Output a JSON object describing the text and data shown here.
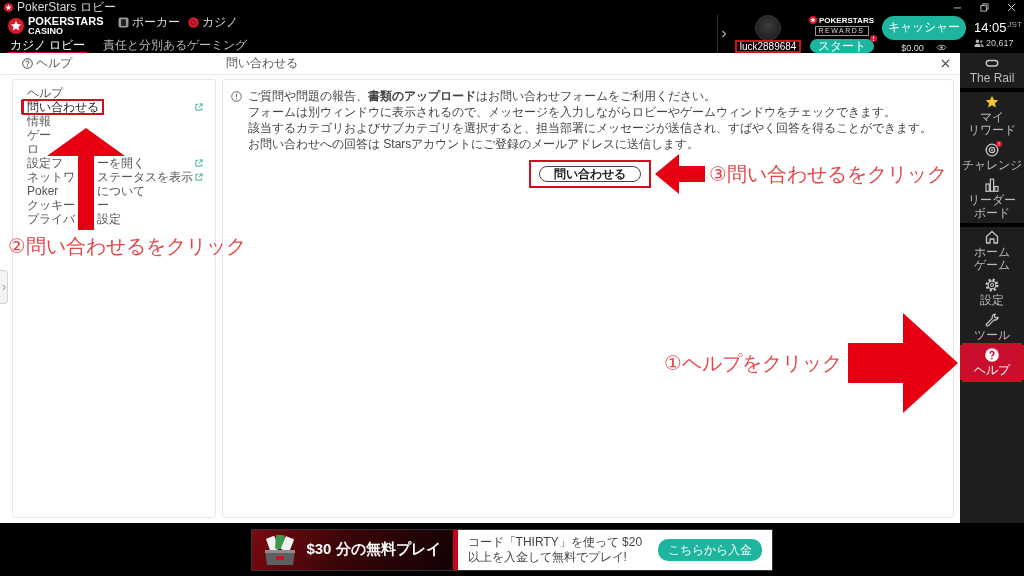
{
  "window": {
    "title": "PokerStars ロビー"
  },
  "top_bar": {
    "brand": {
      "name": "POKERSTARS",
      "subtitle": "CASINO"
    },
    "products": [
      {
        "label": "ポーカー",
        "kind": "poker"
      },
      {
        "label": "カジノ",
        "kind": "casino"
      }
    ],
    "tabs": [
      {
        "label": "カジノ ロビー",
        "selected": true
      },
      {
        "label": "責任と分別あるゲーミング",
        "selected": false
      }
    ],
    "account": {
      "username": "luck2889684",
      "highlighted": true
    },
    "rewards": {
      "brand": "POKERSTARS",
      "subtitle": "REWARDS",
      "button": "スタート",
      "notification": true
    },
    "cashier": {
      "button": "キャッシャー",
      "balance": "$0.00"
    },
    "clock": {
      "time": "14:05",
      "zone": "JST",
      "players": "20,617"
    }
  },
  "help_page": {
    "section": "ヘルプ",
    "title": "問い合わせる",
    "menu": [
      {
        "label_parts": [
          "ヘルプ"
        ],
        "external": false,
        "selected": false,
        "highlighted": false
      },
      {
        "label_parts": [
          "問い合わせる"
        ],
        "external": true,
        "selected": true,
        "highlighted": true
      },
      {
        "label_parts": [
          "情報"
        ],
        "external": false,
        "selected": false,
        "highlighted": false
      },
      {
        "label_parts": [
          "ゲー"
        ],
        "external": false,
        "selected": false,
        "highlighted": false
      },
      {
        "label_parts": [
          "ロ"
        ],
        "external": false,
        "selected": false,
        "highlighted": false
      },
      {
        "label_parts": [
          "設定フ",
          "ーを開く"
        ],
        "external": true,
        "selected": false,
        "highlighted": false
      },
      {
        "label_parts": [
          "ネットワ",
          "ステータスを表示"
        ],
        "external": true,
        "selected": false,
        "highlighted": false
      },
      {
        "label_parts": [
          "Poker",
          "について"
        ],
        "external": false,
        "selected": false,
        "highlighted": false
      },
      {
        "label_parts": [
          "クッキー",
          "ー"
        ],
        "external": false,
        "selected": false,
        "highlighted": false
      },
      {
        "label_parts": [
          "プライバ",
          "設定"
        ],
        "external": false,
        "selected": false,
        "highlighted": false
      }
    ],
    "notice": [
      "ご質問や問題の報告、**書類のアップロード**はお問い合わせフォームをご利用ください。",
      "フォームは別ウィンドウに表示されるので、メッセージを入力しながらロビーやゲームウィンドウをチェックできます。",
      "該当するカテゴリおよびサブカテゴリを選択すると、担当部署にメッセージが送信され、すばやく回答を得ることができます。",
      "お問い合わせへの回答は Starsアカウントにご登録のメールアドレスに送信します。"
    ],
    "contact_button": {
      "label": "問い合わせる",
      "highlighted": true
    }
  },
  "side_nav": {
    "groups": [
      {
        "items": [
          {
            "label_lines": [
              "The Rail"
            ],
            "selected": false,
            "notification": false,
            "highlighted": false
          }
        ]
      },
      {
        "items": [
          {
            "label_lines": [
              "マイ",
              "リワード"
            ],
            "selected": false,
            "notification": false,
            "highlighted": false
          },
          {
            "label_lines": [
              "チャレンジ"
            ],
            "selected": false,
            "notification": true,
            "highlighted": false
          },
          {
            "label_lines": [
              "リーダー",
              "ボード"
            ],
            "selected": false,
            "notification": false,
            "highlighted": false
          }
        ]
      },
      {
        "items": [
          {
            "label_lines": [
              "ホーム",
              "ゲーム"
            ],
            "selected": false,
            "notification": false,
            "highlighted": false
          },
          {
            "label_lines": [
              "設定"
            ],
            "selected": false,
            "notification": false,
            "highlighted": false
          },
          {
            "label_lines": [
              "ツール"
            ],
            "selected": false,
            "notification": false,
            "highlighted": false
          },
          {
            "label_lines": [
              "ヘルプ"
            ],
            "selected": true,
            "notification": false,
            "highlighted": true
          }
        ]
      }
    ]
  },
  "annotations": [
    {
      "text": "③問い合わせるをクリック",
      "kind": "left"
    },
    {
      "text": "②問い合わせるをクリック",
      "kind": "up"
    },
    {
      "text": "①ヘルプをクリック",
      "kind": "right"
    }
  ],
  "promo_banner": {
    "headline": "$30 分の無料プレイ",
    "text": "コード「THIRTY」を使って $20以上を入金して無料でプレイ!",
    "button": "こちらから入金"
  }
}
